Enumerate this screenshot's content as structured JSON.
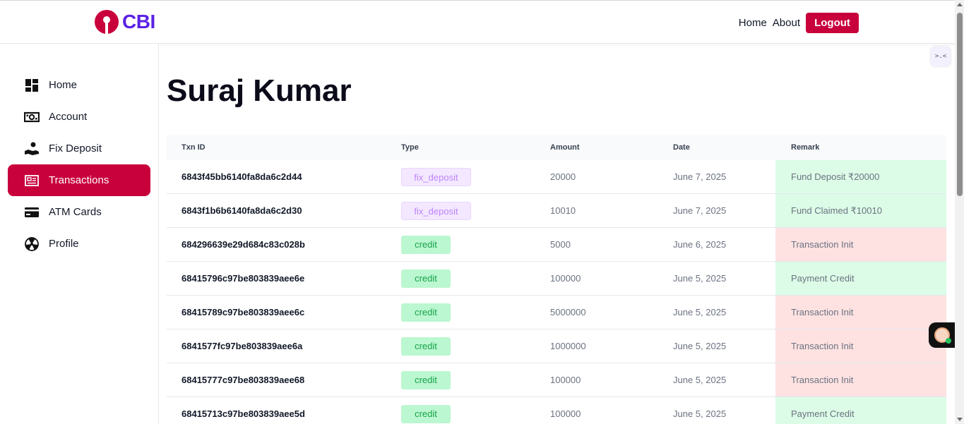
{
  "header": {
    "logo_text": "CBI",
    "nav": [
      "Home",
      "About"
    ],
    "logout_label": "Logout"
  },
  "sidebar": {
    "items": [
      {
        "label": "Home",
        "icon": "dashboard-icon",
        "active": false
      },
      {
        "label": "Account",
        "icon": "cash-icon",
        "active": false
      },
      {
        "label": "Fix Deposit",
        "icon": "hand-coin-icon",
        "active": false
      },
      {
        "label": "Transactions",
        "icon": "receipt-icon",
        "active": true
      },
      {
        "label": "ATM Cards",
        "icon": "credit-card-icon",
        "active": false
      },
      {
        "label": "Profile",
        "icon": "profile-icon",
        "active": false
      }
    ]
  },
  "main": {
    "title": "Suraj Kumar"
  },
  "table": {
    "headers": [
      "Txn ID",
      "Type",
      "Amount",
      "Date",
      "Remark"
    ],
    "rows": [
      {
        "id": "6843f45bb6140fa8da6c2d44",
        "type": "fix_deposit",
        "amount": "20000",
        "date": "June 7, 2025",
        "remark": "Fund Deposit ₹20000",
        "status": "green"
      },
      {
        "id": "6843f1b6b6140fa8da6c2d30",
        "type": "fix_deposit",
        "amount": "10010",
        "date": "June 7, 2025",
        "remark": "Fund Claimed ₹10010",
        "status": "green"
      },
      {
        "id": "684296639e29d684c83c028b",
        "type": "credit",
        "amount": "5000",
        "date": "June 6, 2025",
        "remark": "Transaction Init",
        "status": "red"
      },
      {
        "id": "68415796c97be803839aee6e",
        "type": "credit",
        "amount": "100000",
        "date": "June 5, 2025",
        "remark": "Payment Credit",
        "status": "green"
      },
      {
        "id": "68415789c97be803839aee6c",
        "type": "credit",
        "amount": "5000000",
        "date": "June 5, 2025",
        "remark": "Transaction Init",
        "status": "red"
      },
      {
        "id": "6841577fc97be803839aee6a",
        "type": "credit",
        "amount": "1000000",
        "date": "June 5, 2025",
        "remark": "Transaction Init",
        "status": "red"
      },
      {
        "id": "68415777c97be803839aee68",
        "type": "credit",
        "amount": "100000",
        "date": "June 5, 2025",
        "remark": "Transaction Init",
        "status": "red"
      },
      {
        "id": "68415713c97be803839aee5d",
        "type": "credit",
        "amount": "100000",
        "date": "June 5, 2025",
        "remark": "Payment Credit",
        "status": "green"
      }
    ]
  },
  "colors": {
    "brand": "#c8003c",
    "logo_text": "#5b21e6",
    "remark_green": "#dcfce7",
    "remark_red": "#fee2e2"
  }
}
